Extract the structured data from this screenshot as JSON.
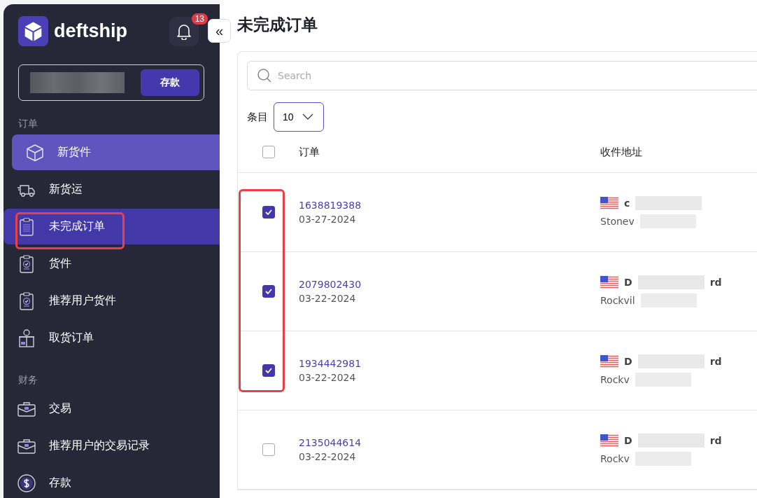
{
  "brand": {
    "name": "deftship"
  },
  "notifications": {
    "count": "13"
  },
  "collapse": {
    "symbol": "«"
  },
  "balance": {
    "button": "存款"
  },
  "sidebar": {
    "sections": [
      {
        "title": "订单",
        "items": [
          {
            "label": "新货件",
            "kind": "cube",
            "hovered": true,
            "selected": false
          },
          {
            "label": "新货运",
            "kind": "truck",
            "hovered": false,
            "selected": false
          },
          {
            "label": "未完成订单",
            "kind": "clipboard",
            "hovered": false,
            "selected": true
          },
          {
            "label": "货件",
            "kind": "shipment",
            "hovered": false,
            "selected": false
          },
          {
            "label": "推荐用户货件",
            "kind": "shipment",
            "hovered": false,
            "selected": false
          },
          {
            "label": "取货订单",
            "kind": "pickup",
            "hovered": false,
            "selected": false
          }
        ]
      },
      {
        "title": "财务",
        "items": [
          {
            "label": "交易",
            "kind": "transaction",
            "hovered": false,
            "selected": false
          },
          {
            "label": "推荐用户的交易记录",
            "kind": "transaction",
            "hovered": false,
            "selected": false
          },
          {
            "label": "存款",
            "kind": "deposit",
            "hovered": false,
            "selected": false
          }
        ]
      }
    ]
  },
  "page": {
    "title": "未完成订单"
  },
  "search": {
    "placeholder": "Search"
  },
  "page_size": {
    "label": "条目",
    "value": "10"
  },
  "table": {
    "columns": [
      "订单",
      "收件地址"
    ],
    "all_checked": false,
    "rows": [
      {
        "checked": true,
        "order": "1638819388",
        "date": "03-27-2024",
        "name_start": "c",
        "city": "Stonev"
      },
      {
        "checked": true,
        "order": "2079802430",
        "date": "03-22-2024",
        "name_start": "D",
        "name_end": "rd",
        "city": "Rockvil"
      },
      {
        "checked": true,
        "order": "1934442981",
        "date": "03-22-2024",
        "name_start": "D",
        "name_end": "rd",
        "city": "Rockv"
      },
      {
        "checked": false,
        "order": "2135044614",
        "date": "03-22-2024",
        "name_start": "D",
        "name_end": "rd",
        "city": "Rockv"
      }
    ]
  }
}
